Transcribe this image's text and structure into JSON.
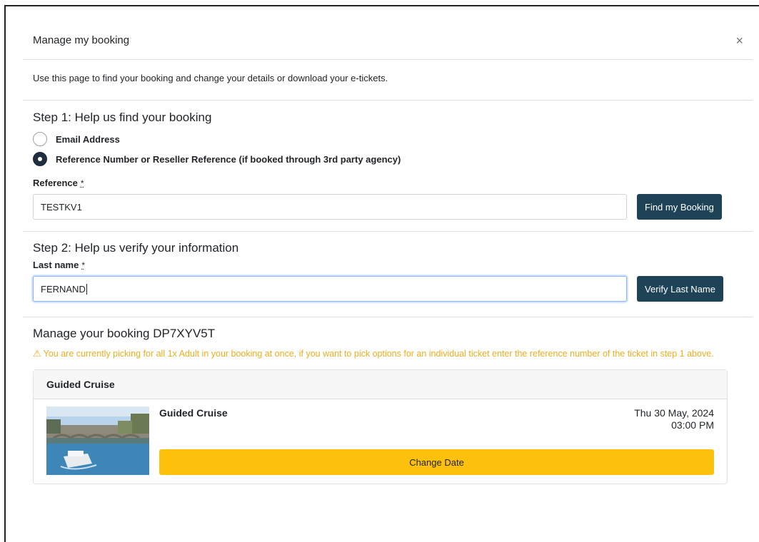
{
  "modal": {
    "title": "Manage my booking",
    "close_icon": "×"
  },
  "intro": "Use this page to find your booking and change your details or download your e-tickets.",
  "step1": {
    "title": "Step 1: Help us find your booking",
    "options": [
      {
        "label": "Email Address",
        "checked": false
      },
      {
        "label": "Reference Number or Reseller Reference (if booked through 3rd party agency)",
        "checked": true
      }
    ],
    "field_label": "Reference",
    "required_mark": "*",
    "value": "TESTKV1",
    "button_label": "Find my Booking"
  },
  "step2": {
    "title": "Step 2: Help us verify your information",
    "field_label": "Last name",
    "required_mark": "*",
    "value": "FERNAND",
    "button_label": "Verify Last Name"
  },
  "manage": {
    "title": "Manage your booking DP7XYV5T",
    "warning": "You are currently picking for all 1x Adult in your booking at once, if you want to pick options for an individual ticket enter the reference number of the ticket in step 1 above.",
    "warning_icon": "warning-triangle-icon"
  },
  "product": {
    "header": "Guided Cruise",
    "name": "Guided Cruise",
    "date": "Thu 30 May, 2024",
    "time": "03:00 PM",
    "button_label": "Change Date"
  },
  "colors": {
    "primary_dark": "#1e4356",
    "warning": "#f0ad1e",
    "change_button": "#fdc00b"
  }
}
